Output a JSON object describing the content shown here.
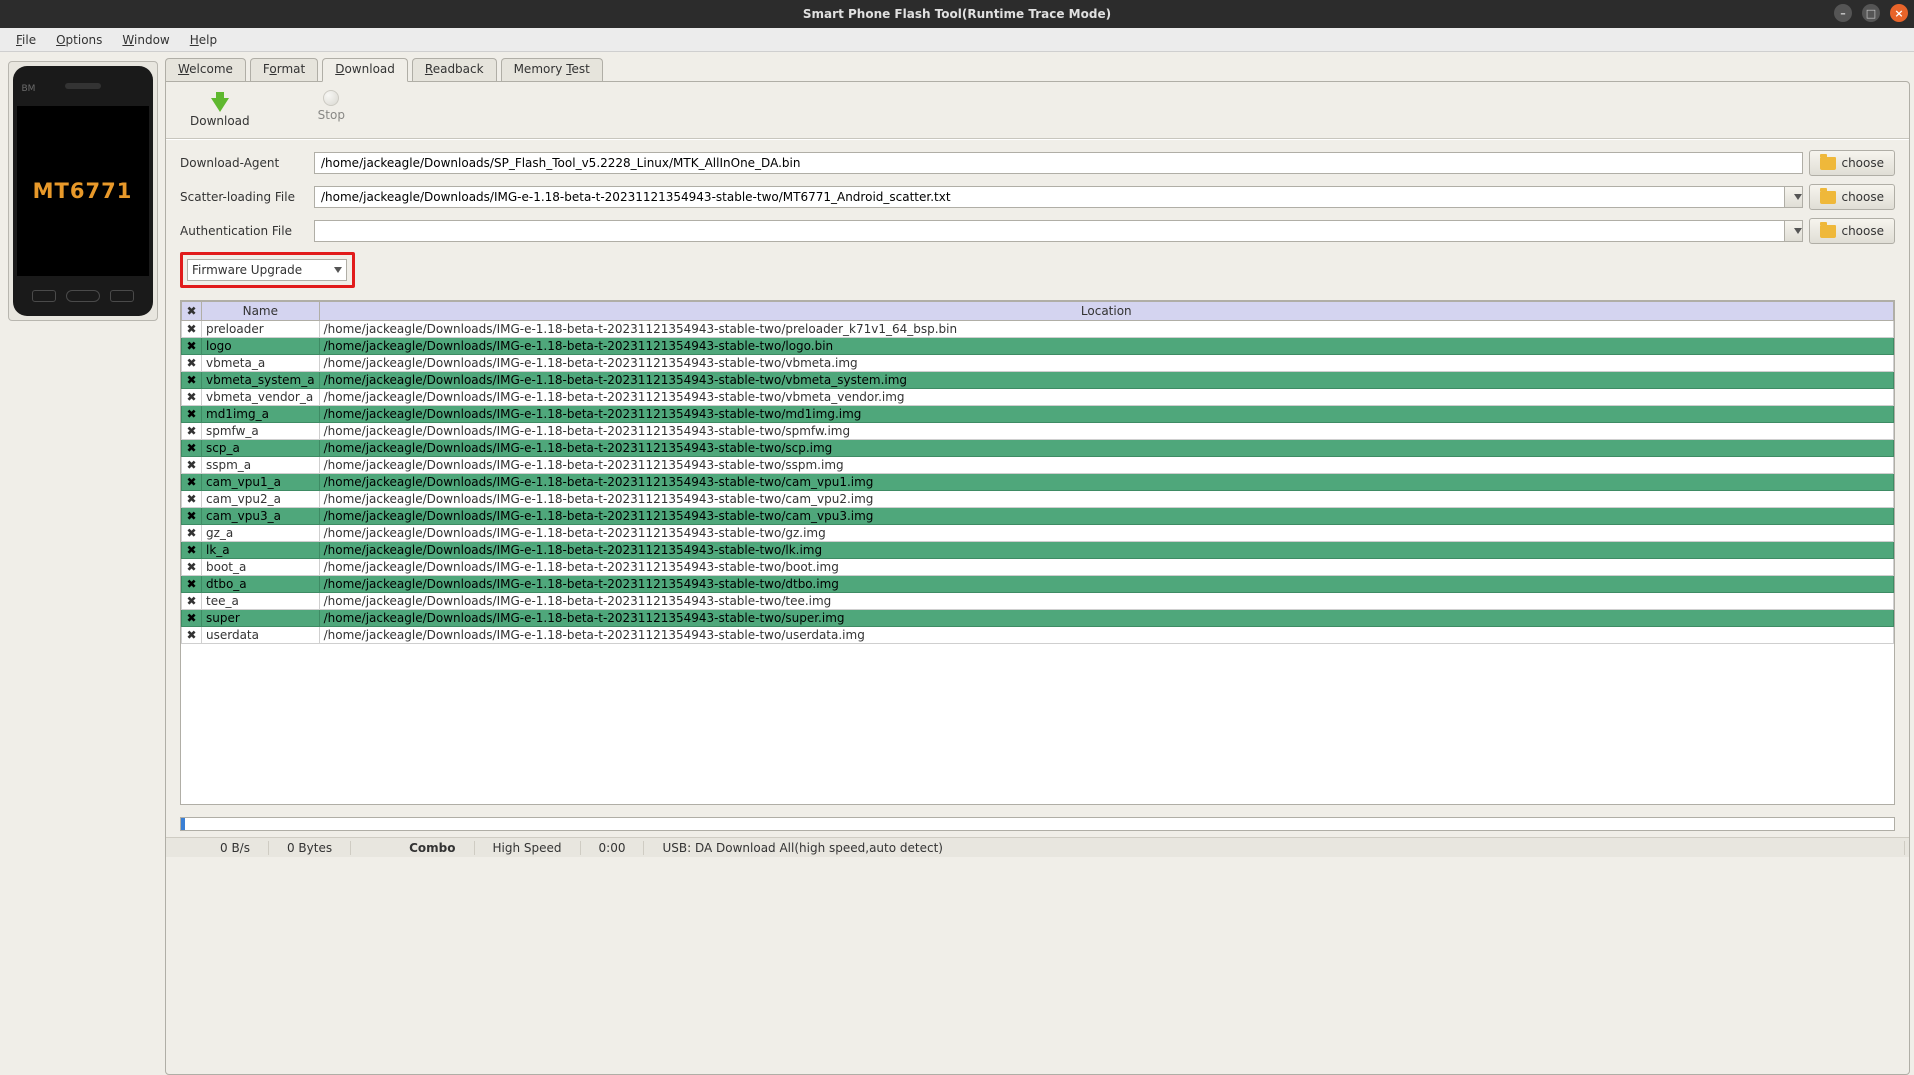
{
  "window": {
    "title": "Smart Phone Flash Tool(Runtime Trace Mode)"
  },
  "menu": {
    "file": "File",
    "options": "Options",
    "window": "Window",
    "help": "Help"
  },
  "chip": "MT6771",
  "tabs": {
    "welcome": "Welcome",
    "format": "Format",
    "download": "Download",
    "readback": "Readback",
    "memory": "Memory Test"
  },
  "toolbar": {
    "download": "Download",
    "stop": "Stop"
  },
  "labels": {
    "da": "Download-Agent",
    "scatter": "Scatter-loading File",
    "auth": "Authentication File",
    "choose": "choose",
    "firmware_mode": "Firmware Upgrade"
  },
  "fields": {
    "da": "/home/jackeagle/Downloads/SP_Flash_Tool_v5.2228_Linux/MTK_AllInOne_DA.bin",
    "scatter": "/home/jackeagle/Downloads/IMG-e-1.18-beta-t-20231121354943-stable-two/MT6771_Android_scatter.txt",
    "auth": ""
  },
  "columns": {
    "name": "Name",
    "location": "Location"
  },
  "partitions": [
    {
      "name": "preloader",
      "loc": "/home/jackeagle/Downloads/IMG-e-1.18-beta-t-20231121354943-stable-two/preloader_k71v1_64_bsp.bin"
    },
    {
      "name": "logo",
      "loc": "/home/jackeagle/Downloads/IMG-e-1.18-beta-t-20231121354943-stable-two/logo.bin"
    },
    {
      "name": "vbmeta_a",
      "loc": "/home/jackeagle/Downloads/IMG-e-1.18-beta-t-20231121354943-stable-two/vbmeta.img"
    },
    {
      "name": "vbmeta_system_a",
      "loc": "/home/jackeagle/Downloads/IMG-e-1.18-beta-t-20231121354943-stable-two/vbmeta_system.img"
    },
    {
      "name": "vbmeta_vendor_a",
      "loc": "/home/jackeagle/Downloads/IMG-e-1.18-beta-t-20231121354943-stable-two/vbmeta_vendor.img"
    },
    {
      "name": "md1img_a",
      "loc": "/home/jackeagle/Downloads/IMG-e-1.18-beta-t-20231121354943-stable-two/md1img.img"
    },
    {
      "name": "spmfw_a",
      "loc": "/home/jackeagle/Downloads/IMG-e-1.18-beta-t-20231121354943-stable-two/spmfw.img"
    },
    {
      "name": "scp_a",
      "loc": "/home/jackeagle/Downloads/IMG-e-1.18-beta-t-20231121354943-stable-two/scp.img"
    },
    {
      "name": "sspm_a",
      "loc": "/home/jackeagle/Downloads/IMG-e-1.18-beta-t-20231121354943-stable-two/sspm.img"
    },
    {
      "name": "cam_vpu1_a",
      "loc": "/home/jackeagle/Downloads/IMG-e-1.18-beta-t-20231121354943-stable-two/cam_vpu1.img"
    },
    {
      "name": "cam_vpu2_a",
      "loc": "/home/jackeagle/Downloads/IMG-e-1.18-beta-t-20231121354943-stable-two/cam_vpu2.img"
    },
    {
      "name": "cam_vpu3_a",
      "loc": "/home/jackeagle/Downloads/IMG-e-1.18-beta-t-20231121354943-stable-two/cam_vpu3.img"
    },
    {
      "name": "gz_a",
      "loc": "/home/jackeagle/Downloads/IMG-e-1.18-beta-t-20231121354943-stable-two/gz.img"
    },
    {
      "name": "lk_a",
      "loc": "/home/jackeagle/Downloads/IMG-e-1.18-beta-t-20231121354943-stable-two/lk.img"
    },
    {
      "name": "boot_a",
      "loc": "/home/jackeagle/Downloads/IMG-e-1.18-beta-t-20231121354943-stable-two/boot.img"
    },
    {
      "name": "dtbo_a",
      "loc": "/home/jackeagle/Downloads/IMG-e-1.18-beta-t-20231121354943-stable-two/dtbo.img"
    },
    {
      "name": "tee_a",
      "loc": "/home/jackeagle/Downloads/IMG-e-1.18-beta-t-20231121354943-stable-two/tee.img"
    },
    {
      "name": "super",
      "loc": "/home/jackeagle/Downloads/IMG-e-1.18-beta-t-20231121354943-stable-two/super.img"
    },
    {
      "name": "userdata",
      "loc": "/home/jackeagle/Downloads/IMG-e-1.18-beta-t-20231121354943-stable-two/userdata.img"
    }
  ],
  "status": {
    "speed": "0 B/s",
    "size": "0 Bytes",
    "mode": "Combo",
    "usb_speed": "High Speed",
    "time": "0:00",
    "usb": "USB: DA Download All(high speed,auto detect)"
  }
}
